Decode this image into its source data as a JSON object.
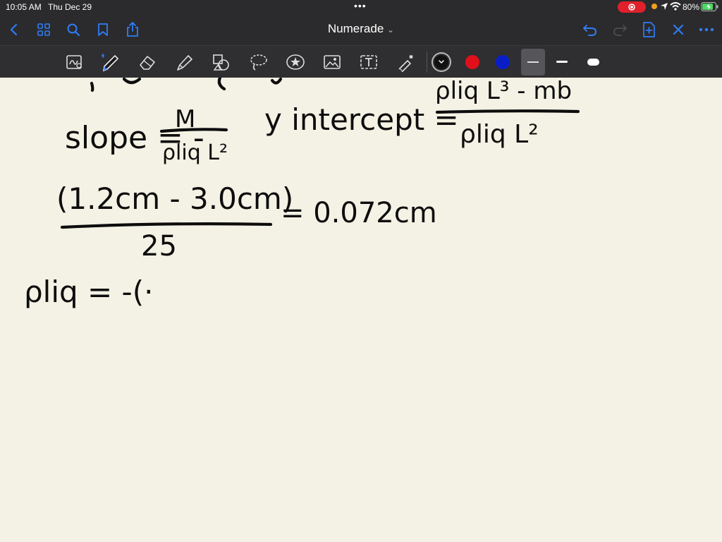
{
  "status_bar": {
    "time": "10:05 AM",
    "date": "Thu Dec 29",
    "battery": "80%"
  },
  "nav": {
    "title": "Numerade",
    "title_chevron": "⌄"
  },
  "toolbar": {
    "active_tool": "pen",
    "colors": {
      "black": "#111111",
      "red": "#e0101a",
      "blue": "#0a1ec8"
    },
    "accent": "#2f7df6"
  },
  "handwriting": {
    "slope_lhs": "slope = -",
    "slope_num": "M",
    "slope_den": "ρliq L²",
    "yint_lhs": "y intercept =",
    "yint_num": "ρliq L³ - mb",
    "yint_den": "ρliq L²",
    "frac_num": "(1.2cm - 3.0cm)",
    "frac_den": "25",
    "frac_result": "= 0.072cm",
    "rho_line": "ρliq = -(·"
  }
}
